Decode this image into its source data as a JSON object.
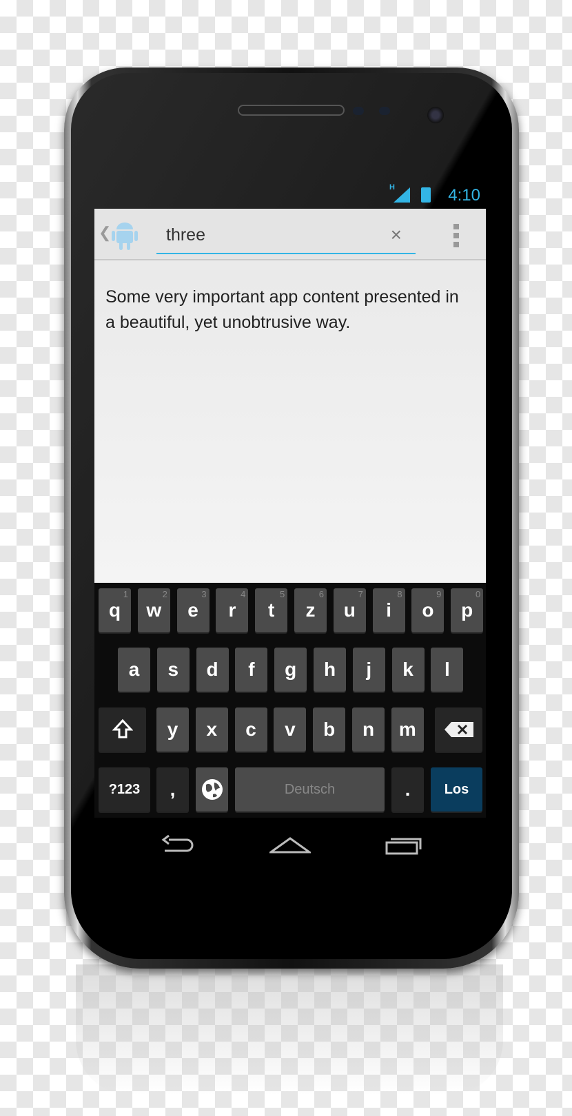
{
  "status_bar": {
    "network": "H",
    "time": "4:10",
    "accent": "#33b5e5"
  },
  "action_bar": {
    "up_icon": "chevron-left",
    "app_icon": "android-robot",
    "search_value": "three",
    "clear_icon": "×",
    "overflow_icon": "vertical-dots"
  },
  "content": {
    "text": "Some very important app content presented in a beautiful, yet unobtrusive way."
  },
  "keyboard": {
    "row1": [
      {
        "k": "q",
        "n": "1"
      },
      {
        "k": "w",
        "n": "2"
      },
      {
        "k": "e",
        "n": "3"
      },
      {
        "k": "r",
        "n": "4"
      },
      {
        "k": "t",
        "n": "5"
      },
      {
        "k": "z",
        "n": "6"
      },
      {
        "k": "u",
        "n": "7"
      },
      {
        "k": "i",
        "n": "8"
      },
      {
        "k": "o",
        "n": "9"
      },
      {
        "k": "p",
        "n": "0"
      }
    ],
    "row2": [
      "a",
      "s",
      "d",
      "f",
      "g",
      "h",
      "j",
      "k",
      "l"
    ],
    "row3": [
      "y",
      "x",
      "c",
      "v",
      "b",
      "n",
      "m"
    ],
    "symbols": "?123",
    "comma": ",",
    "space": "Deutsch",
    "period": ".",
    "go": "Los",
    "go_color": "#0a3d5e"
  },
  "nav": {
    "back": "back-icon",
    "home": "home-icon",
    "recents": "recents-icon"
  }
}
